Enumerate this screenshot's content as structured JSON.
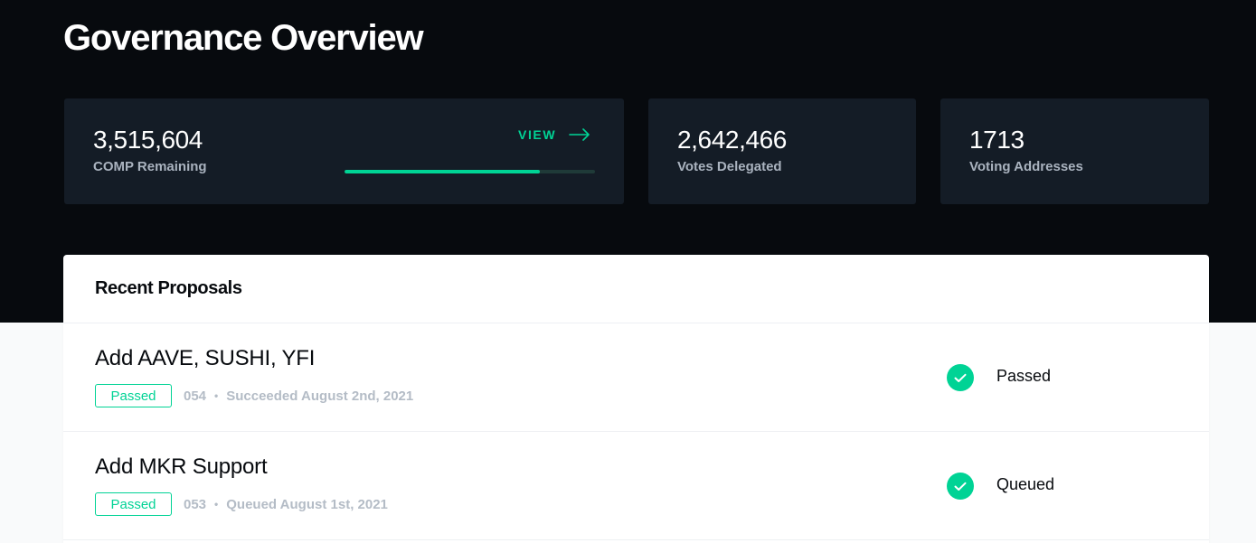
{
  "header": {
    "title": "Governance Overview"
  },
  "stats": {
    "comp": {
      "value": "3,515,604",
      "label": "COMP Remaining",
      "view_label": "VIEW",
      "progress_fraction": 0.78
    },
    "votes": {
      "value": "2,642,466",
      "label": "Votes Delegated"
    },
    "addresses": {
      "value": "1713",
      "label": "Voting Addresses"
    }
  },
  "proposals": {
    "title": "Recent Proposals",
    "items": [
      {
        "title": "Add AAVE, SUSHI, YFI",
        "tag": "Passed",
        "id": "054",
        "detail": "Succeeded August 2nd, 2021",
        "state": "Passed"
      },
      {
        "title": "Add MKR Support",
        "tag": "Passed",
        "id": "053",
        "detail": "Queued August 1st, 2021",
        "state": "Queued"
      }
    ]
  },
  "colors": {
    "accent": "#00d395",
    "hero_background": "#070a0e",
    "card_background": "#141c26"
  },
  "icons": {
    "view": "arrow-right-icon",
    "state": "check-circle-icon"
  }
}
